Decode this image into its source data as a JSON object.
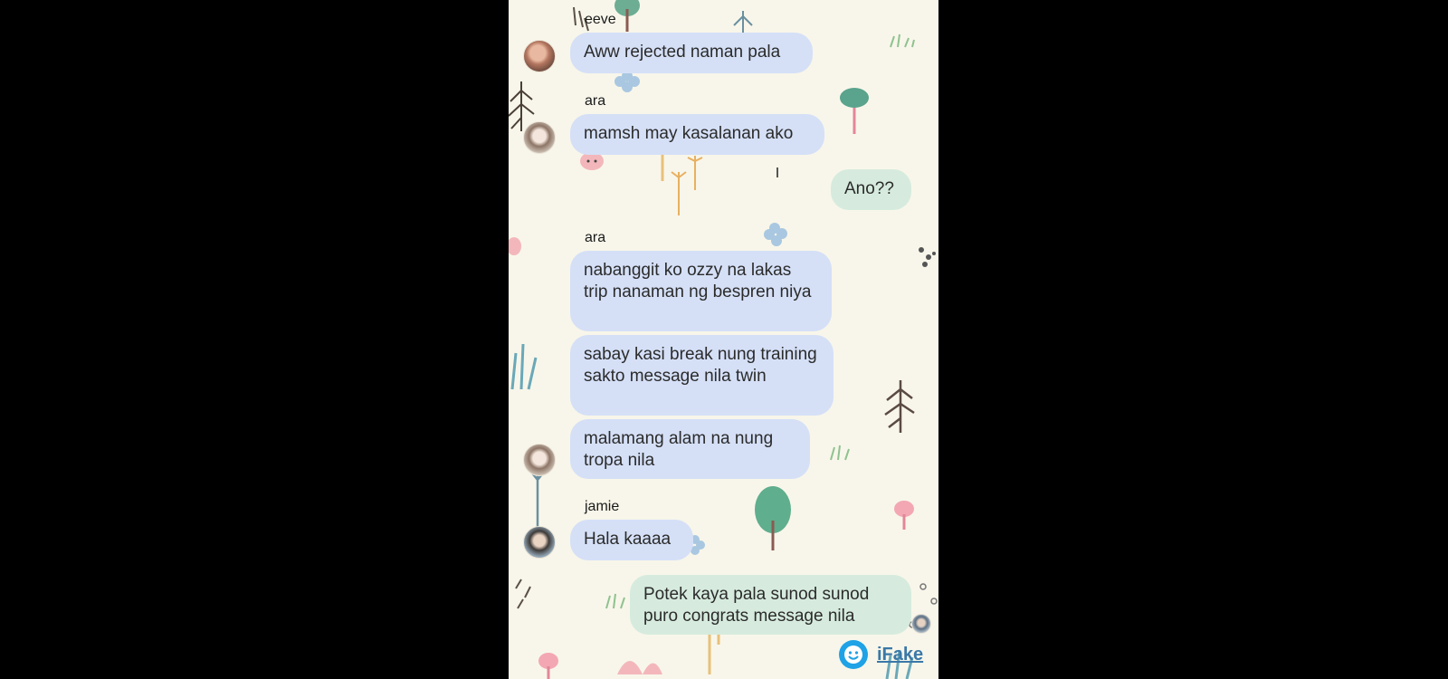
{
  "conversation": {
    "blocks": [
      {
        "sender": "eeve",
        "avatar": "eeve-avatar",
        "messages": [
          "Aww rejected naman pala"
        ]
      },
      {
        "sender": "ara",
        "avatar": "ara-avatar",
        "messages": [
          "mamsh may kasalanan ako"
        ]
      },
      {
        "sender": "me",
        "messages": [
          "Ano??"
        ]
      },
      {
        "sender": "ara",
        "avatar": "ara-avatar",
        "messages": [
          "nabanggit ko ozzy na lakas trip nanaman ng bespren niya",
          "sabay kasi break nung training sakto message nila twin",
          "malamang alam na nung tropa nila"
        ]
      },
      {
        "sender": "jamie",
        "avatar": "jamie-avatar",
        "messages": [
          "Hala kaaaa"
        ]
      },
      {
        "sender": "me",
        "avatar": "me-avatar",
        "messages": [
          "Potek kaya pala sunod sunod puro congrats message nila"
        ]
      }
    ]
  },
  "colors": {
    "background": "#f8f6ea",
    "incoming_bubble": "#d5e0f7",
    "outgoing_bubble": "#d6ebde",
    "watermark_blue": "#1fa2e6"
  },
  "watermark": {
    "text": "iFake",
    "icon": "smiley-icon"
  }
}
